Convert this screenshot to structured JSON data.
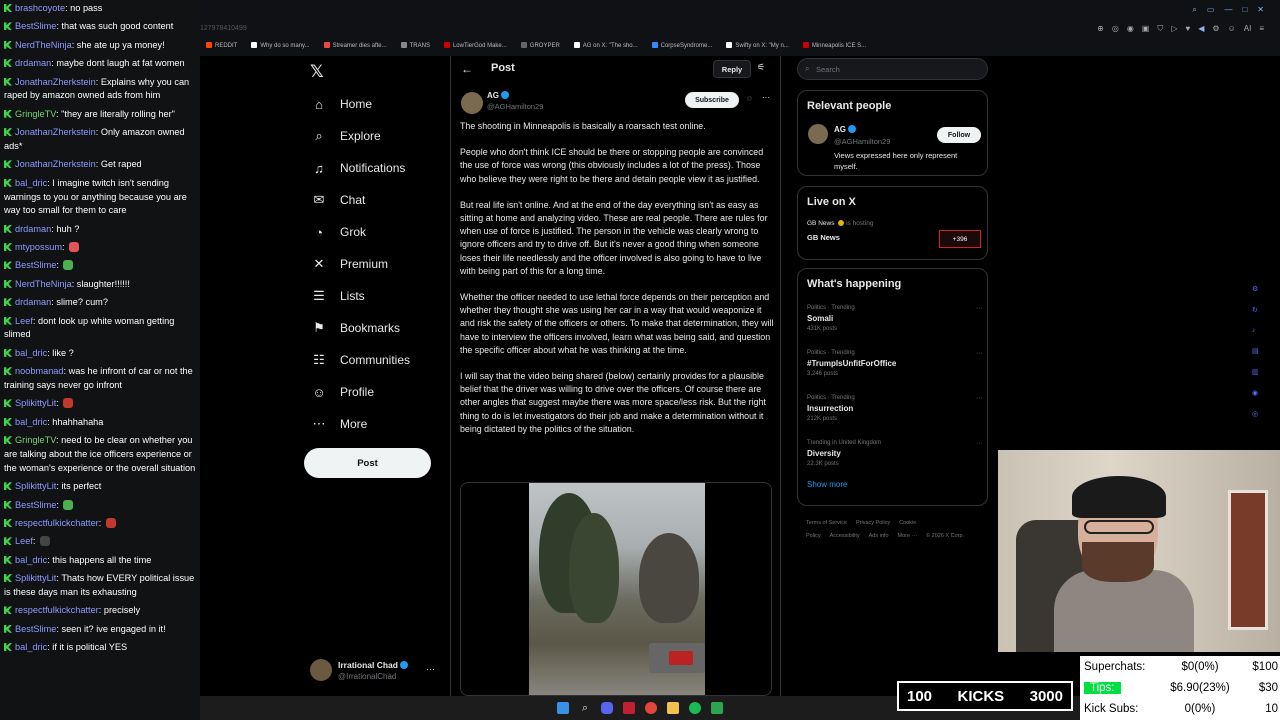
{
  "chat": {
    "messages": [
      {
        "user": "brashcoyote",
        "text": "no pass",
        "color": "#8e9cff"
      },
      {
        "user": "BestSlime",
        "text": "that was such good content",
        "color": "#8e9cff"
      },
      {
        "user": "NerdTheNinja",
        "text": "she ate up ya money!",
        "color": "#8e9cff"
      },
      {
        "user": "drdaman",
        "text": "maybe dont laugh at fat women",
        "color": "#8e9cff"
      },
      {
        "user": "JonathanZherkstein",
        "text": "Explains why you can raped by amazon owned ads from him",
        "color": "#8e9cff"
      },
      {
        "user": "GringleTV",
        "text": "\"they are literally rolling her\"",
        "color": "#7ad27a"
      },
      {
        "user": "JonathanZherkstein",
        "text": "Only amazon owned ads*",
        "color": "#8e9cff"
      },
      {
        "user": "JonathanZherkstein",
        "text": "Get raped",
        "color": "#8e9cff"
      },
      {
        "user": "bal_dric",
        "text": "I imagine twitch isn't sending warnings to you or anything because you are way too small for them to care",
        "color": "#8e9cff"
      },
      {
        "user": "drdaman",
        "text": "huh ?",
        "color": "#8e9cff"
      },
      {
        "user": "mtypossum",
        "text": "",
        "color": "#8e9cff"
      },
      {
        "user": "BestSlime",
        "text": "",
        "color": "#8e9cff"
      },
      {
        "user": "NerdTheNinja",
        "text": "slaughter!!!!!!",
        "color": "#8e9cff"
      },
      {
        "user": "drdaman",
        "text": "slime? cum?",
        "color": "#8e9cff"
      },
      {
        "user": "Leef",
        "text": "dont look up white woman getting slimed",
        "color": "#8e9cff"
      },
      {
        "user": "bal_dric",
        "text": "like ?",
        "color": "#8e9cff"
      },
      {
        "user": "noobmanad",
        "text": "was he infront of car or not the training says never go infront",
        "color": "#8e9cff"
      },
      {
        "user": "SplikittyLit",
        "text": "",
        "color": "#8e9cff"
      },
      {
        "user": "bal_dric",
        "text": "hhahhahaha",
        "color": "#8e9cff"
      },
      {
        "user": "GringleTV",
        "text": "need to be clear on whether you are talking about the ice officers experience or the woman's experience or the overall situation",
        "color": "#7ad27a"
      },
      {
        "user": "SplikittyLit",
        "text": "its perfect",
        "color": "#8e9cff"
      },
      {
        "user": "BestSlime",
        "text": "",
        "color": "#8e9cff"
      },
      {
        "user": "respectfulkickchatter",
        "text": "",
        "color": "#8e9cff"
      },
      {
        "user": "Leef",
        "text": "",
        "color": "#8e9cff"
      },
      {
        "user": "bal_dric",
        "text": "this happens all the time",
        "color": "#8e9cff"
      },
      {
        "user": "SplikittyLit",
        "text": "Thats how EVERY political issue is these days man its exhausting",
        "color": "#8e9cff"
      },
      {
        "user": "respectfulkickchatter",
        "text": "precisely",
        "color": "#8e9cff"
      },
      {
        "user": "BestSlime",
        "text": "seen it? ive engaged in it!",
        "color": "#8e9cff"
      },
      {
        "user": "bal_dric",
        "text": "if it is political YES",
        "color": "#8e9cff"
      }
    ]
  },
  "browser": {
    "url": "127978410499",
    "bookmarks": [
      "REDDIT",
      "Why do so many...",
      "Streamer dies afte...",
      "TRANS",
      "LowTierGod Make...",
      "GROYPER",
      "AG on X: \"The sho...",
      "CorpseSyndrome...",
      "Swifty on X: \"My n...",
      "Minneapolis ICE S..."
    ],
    "toolbar_icons": [
      "zoom-icon",
      "reader-icon",
      "eye-icon",
      "tab-icon",
      "shield-icon",
      "play-icon",
      "heart-icon",
      "sound-icon",
      "extension-icon",
      "profile-icon",
      "menu-icon"
    ],
    "ai_label": "AI"
  },
  "nav": {
    "logo": "𝕏",
    "items": [
      {
        "label": "Home",
        "icon": "⌂"
      },
      {
        "label": "Explore",
        "icon": "⌕"
      },
      {
        "label": "Notifications",
        "icon": "♫"
      },
      {
        "label": "Chat",
        "icon": "✉"
      },
      {
        "label": "Grok",
        "icon": "◔"
      },
      {
        "label": "Premium",
        "icon": "✕"
      },
      {
        "label": "Lists",
        "icon": "☰"
      },
      {
        "label": "Bookmarks",
        "icon": "⚑"
      },
      {
        "label": "Communities",
        "icon": "☷"
      },
      {
        "label": "Profile",
        "icon": "☺"
      },
      {
        "label": "More",
        "icon": "⋯"
      }
    ],
    "post_button": "Post",
    "profile": {
      "name": "Irrational Chad",
      "handle": "@IrrationalChad"
    }
  },
  "post": {
    "header_title": "Post",
    "reply_button": "Reply",
    "author_name": "AG",
    "author_handle": "@AGHamilton29",
    "subscribe_button": "Subscribe",
    "paragraphs": [
      "The shooting in Minneapolis is basically a roarsach test online.",
      "People who don't think ICE should be there or stopping people are convinced the use of force was wrong (this obviously includes a lot of the press). Those who believe they were right to be there and detain people view it as justified.",
      "But real life isn't online. And at the end of the day everything isn't as easy as sitting at home and analyzing video. These are real people. There are rules for when use of force is justified. The person in the vehicle was clearly wrong to ignore officers and try to drive off. But it's never a good thing when someone loses their life needlessly and the officer involved is also going to have to live with being part of this for a long time.",
      "Whether the officer needed to use lethal force depends on their perception and whether they thought she was using her car in a way that would weaponize it and risk the safety of the officers or others. To make that determination, they will have to interview the officers involved, learn what was being said, and question the specific officer about what he was thinking at the time.",
      "I will say that the video being shared (below) certainly provides for a plausible belief that the driver was willing to drive over the officers. Of course there are other angles that suggest maybe there was more space/less risk. But the right thing to do is let investigators do their job and make a determination without it being dictated by the politics of the situation."
    ]
  },
  "right": {
    "search_placeholder": "Search",
    "relevant": {
      "title": "Relevant people",
      "name": "AG",
      "handle": "@AGHamilton29",
      "follow_button": "Follow",
      "bio": "Views expressed here only represent myself."
    },
    "live": {
      "title": "Live on X",
      "host": "GB News",
      "hosting_label": "is hosting",
      "stream_title": "GB News",
      "viewers": "+396"
    },
    "happening": {
      "title": "What's happening",
      "trends": [
        {
          "category": "Politics · Trending",
          "name": "Somali",
          "count": "431K posts"
        },
        {
          "category": "Politics · Trending",
          "name": "#TrumpIsUnfitForOffice",
          "count": "3,246 posts"
        },
        {
          "category": "Politics · Trending",
          "name": "Insurrection",
          "count": "212K posts"
        },
        {
          "category": "Trending in United Kingdom",
          "name": "Diversity",
          "count": "22.3K posts"
        }
      ],
      "show_more": "Show more"
    },
    "footer": [
      "Terms of Service",
      "Privacy Policy",
      "Cookie Policy",
      "Accessibility",
      "Ads info",
      "More ···",
      "© 2026 X Corp."
    ]
  },
  "overlay": {
    "kicks": {
      "left": "100",
      "label": "KICKS",
      "right": "3000"
    },
    "stats": [
      {
        "label": "Superchats:",
        "value": "$0(0%)",
        "goal": "$100"
      },
      {
        "label": "Tips:",
        "value": "$6.90(23%)",
        "goal": "$30"
      },
      {
        "label": "Kick Subs:",
        "value": "0(0%)",
        "goal": "10"
      }
    ]
  }
}
